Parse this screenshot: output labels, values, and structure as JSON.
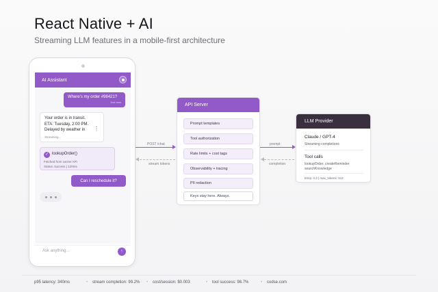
{
  "header": {
    "title": "React Native + AI",
    "subtitle": "Streaming LLM features in a mobile-first architecture"
  },
  "phone": {
    "app_title": "AI Assistant",
    "settings_icon": "settings-icon",
    "messages": {
      "user1": {
        "text": "Where's my order #98421?",
        "time": "Just now"
      },
      "bot1": {
        "line1": "Your order is in transit.",
        "line2": "ETA: Tuesday, 2:00 PM.",
        "line3": "Delayed by weather in",
        "status": "Streaming..."
      },
      "tool": {
        "name": "lookupOrder()",
        "detail": "Fetched from carrier API",
        "status": "Status: success | 120ms"
      },
      "user2": {
        "text": "Can I reschedule it?"
      }
    },
    "input": {
      "placeholder": "Ask anything..."
    }
  },
  "flows": {
    "left_request": "POST /chat",
    "left_response": "stream tokens",
    "right_request": "prompt",
    "right_response": "completion"
  },
  "api_server": {
    "title": "API Server",
    "items": [
      "Prompt templates",
      "Tool authorization",
      "Rate limits + cost tags",
      "Observability + tracing",
      "PII redaction"
    ],
    "note": "Keys stay here. Always."
  },
  "llm_provider": {
    "title": "LLM Provider",
    "model": "Claude / GPT-4",
    "model_sub": "Streaming completions",
    "tools_title": "Tool calls",
    "tools_list": "lookupOrder, createReminder searchKnowledge",
    "params": "temp: 0.2 | max_tokens: 512"
  },
  "footer": {
    "stats": [
      "p95 latency: 340ms",
      "stream completion: 99.2%",
      "cost/session: $0.003",
      "tool success: 98.7%",
      "codse.com"
    ]
  },
  "colors": {
    "accent": "#9259c8",
    "dark_header": "#3a2f3f"
  }
}
